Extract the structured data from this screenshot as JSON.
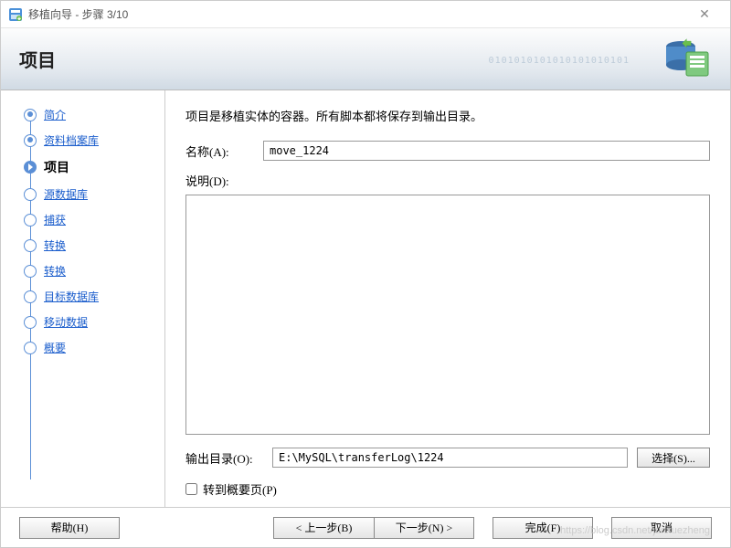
{
  "titlebar": {
    "title": "移植向导 - 步骤 3/10"
  },
  "header": {
    "title": "项目",
    "binary": "0101010101010101010101"
  },
  "sidebar": {
    "steps": [
      {
        "label": "简介",
        "state": "done"
      },
      {
        "label": "资料档案库",
        "state": "done"
      },
      {
        "label": "项目",
        "state": "current"
      },
      {
        "label": "源数据库",
        "state": "future"
      },
      {
        "label": "捕获",
        "state": "future"
      },
      {
        "label": "转换",
        "state": "future"
      },
      {
        "label": "转换",
        "state": "future"
      },
      {
        "label": "目标数据库",
        "state": "future"
      },
      {
        "label": "移动数据",
        "state": "future"
      },
      {
        "label": "概要",
        "state": "future"
      }
    ]
  },
  "main": {
    "intro": "项目是移植实体的容器。所有脚本都将保存到输出目录。",
    "name_label": "名称(A):",
    "name_value": "move_1224",
    "desc_label": "说明(D):",
    "desc_value": "",
    "out_label": "输出目录(O):",
    "out_value": "E:\\MySQL\\transferLog\\1224",
    "select_label": "选择(S)...",
    "check_label": "转到概要页(P)"
  },
  "footer": {
    "help": "帮助(H)",
    "back": "< 上一步(B)",
    "next": "下一步(N) >",
    "finish": "完成(F)",
    "cancel": "取消"
  },
  "watermark": "https://blog.csdn.net/junxuezheng"
}
